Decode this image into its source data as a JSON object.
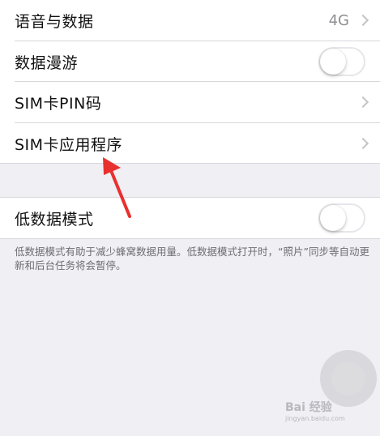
{
  "rows": [
    {
      "label": "语音与数据",
      "value": "4G"
    },
    {
      "label": "数据漫游"
    },
    {
      "label": "SIM卡PIN码"
    },
    {
      "label": "SIM卡应用程序"
    }
  ],
  "low_data": {
    "label": "低数据模式",
    "footnote": "低数据模式有助于减少蜂窝数据用量。低数据模式打开时，“照片”同步等自动更新和后台任务将会暂停。"
  },
  "toggles": {
    "data_roaming_on": false,
    "low_data_on": false
  },
  "colors": {
    "background": "#efeff4",
    "arrow": "#e8312f",
    "chevron": "#c4c4c7"
  },
  "watermark": {
    "brand": "Bai 经验",
    "sub": "jingyan.baidu.com"
  }
}
